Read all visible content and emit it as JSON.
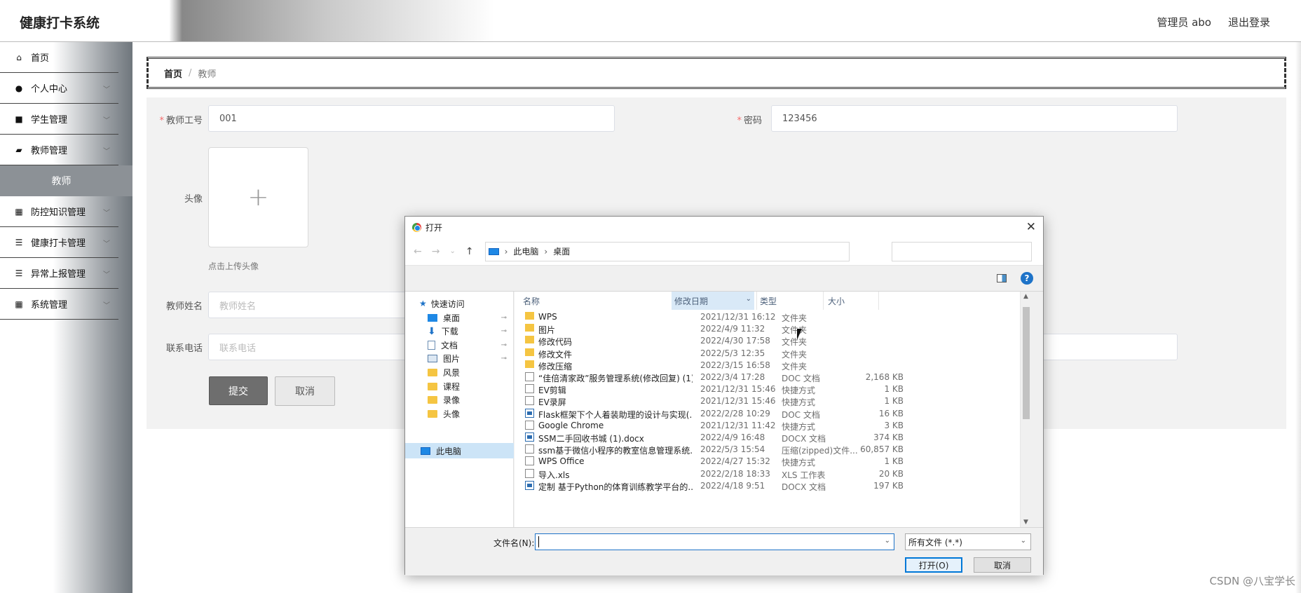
{
  "header": {
    "app_title": "健康打卡系统",
    "admin_label": "管理员 abo",
    "logout_label": "退出登录"
  },
  "sidebar": {
    "items": [
      {
        "label": "首页",
        "icon": "home-icon",
        "glyph": "⌂",
        "has_chevron": false
      },
      {
        "label": "个人中心",
        "icon": "user-icon",
        "glyph": "●",
        "has_chevron": true
      },
      {
        "label": "学生管理",
        "icon": "student-icon",
        "glyph": "■",
        "has_chevron": true
      },
      {
        "label": "教师管理",
        "icon": "teacher-icon",
        "glyph": "▰",
        "has_chevron": true
      }
    ],
    "active_sub": "教师",
    "items_after": [
      {
        "label": "防控知识管理",
        "icon": "grid-icon",
        "glyph": "▦",
        "has_chevron": true
      },
      {
        "label": "健康打卡管理",
        "icon": "list-icon",
        "glyph": "☰",
        "has_chevron": true
      },
      {
        "label": "异常上报管理",
        "icon": "list-icon",
        "glyph": "☰",
        "has_chevron": true
      },
      {
        "label": "系统管理",
        "icon": "grid-icon",
        "glyph": "▦",
        "has_chevron": true
      }
    ],
    "chevron": "﹀"
  },
  "breadcrumb": {
    "home": "首页",
    "separator": "/",
    "current": "教师"
  },
  "form": {
    "teacher_id_label": "教师工号",
    "teacher_id_value": "001",
    "password_label": "密码",
    "password_value": "123456",
    "avatar_label": "头像",
    "avatar_plus": "+",
    "upload_tip": "点击上传头像",
    "name_label": "教师姓名",
    "name_placeholder": "教师姓名",
    "phone_label": "联系电话",
    "phone_placeholder": "联系电话",
    "submit_label": "提交",
    "cancel_label": "取消",
    "required_mark": "*"
  },
  "dialog": {
    "title": "打开",
    "close_glyph": "✕",
    "back_glyph": "←",
    "forward_glyph": "→",
    "recent_glyph": "⌄",
    "up_glyph": "↑",
    "path": [
      "此电脑",
      "桌面"
    ],
    "path_sep": "›",
    "help_glyph": "?",
    "nav_pane": {
      "quick_access": "快速访问",
      "items": [
        {
          "label": "桌面",
          "icon": "desktop-icon",
          "pinned": true
        },
        {
          "label": "下载",
          "icon": "download-icon",
          "pinned": true
        },
        {
          "label": "文档",
          "icon": "document-icon",
          "pinned": true
        },
        {
          "label": "图片",
          "icon": "picture-icon",
          "pinned": true
        },
        {
          "label": "风景",
          "icon": "folder-icon",
          "pinned": false
        },
        {
          "label": "课程",
          "icon": "folder-icon",
          "pinned": false
        },
        {
          "label": "录像",
          "icon": "folder-icon",
          "pinned": false
        },
        {
          "label": "头像",
          "icon": "folder-icon",
          "pinned": false
        }
      ],
      "this_pc": "此电脑",
      "pin_glyph": "📌"
    },
    "columns": {
      "name": "名称",
      "date": "修改日期",
      "type": "类型",
      "size": "大小"
    },
    "files": [
      {
        "name": "WPS",
        "date": "2021/12/31 16:12",
        "type": "文件夹",
        "size": "",
        "icon": "folder"
      },
      {
        "name": "图片",
        "date": "2022/4/9 11:32",
        "type": "文件夹",
        "size": "",
        "icon": "folder"
      },
      {
        "name": "修改代码",
        "date": "2022/4/30 17:58",
        "type": "文件夹",
        "size": "",
        "icon": "folder"
      },
      {
        "name": "修改文件",
        "date": "2022/5/3 12:35",
        "type": "文件夹",
        "size": "",
        "icon": "folder"
      },
      {
        "name": "修改压缩",
        "date": "2022/3/15 16:58",
        "type": "文件夹",
        "size": "",
        "icon": "folder"
      },
      {
        "name": "“佳倍清家政”服务管理系统(修改回复) (1)...",
        "date": "2022/3/4 17:28",
        "type": "DOC 文档",
        "size": "2,168 KB",
        "icon": "doc"
      },
      {
        "name": "EV剪辑",
        "date": "2021/12/31 15:46",
        "type": "快捷方式",
        "size": "1 KB",
        "icon": "doc"
      },
      {
        "name": "EV录屏",
        "date": "2021/12/31 15:46",
        "type": "快捷方式",
        "size": "1 KB",
        "icon": "doc"
      },
      {
        "name": "Flask框架下个人着装助理的设计与实现(...",
        "date": "2022/2/28 10:29",
        "type": "DOC 文档",
        "size": "16 KB",
        "icon": "word"
      },
      {
        "name": "Google Chrome",
        "date": "2021/12/31 11:42",
        "type": "快捷方式",
        "size": "3 KB",
        "icon": "doc"
      },
      {
        "name": "SSM二手回收书城 (1).docx",
        "date": "2022/4/9 16:48",
        "type": "DOCX 文档",
        "size": "374 KB",
        "icon": "word"
      },
      {
        "name": "ssm基于微信小程序的教室信息管理系统...",
        "date": "2022/5/3 15:54",
        "type": "压缩(zipped)文件...",
        "size": "60,857 KB",
        "icon": "doc"
      },
      {
        "name": "WPS Office",
        "date": "2022/4/27 15:32",
        "type": "快捷方式",
        "size": "1 KB",
        "icon": "doc"
      },
      {
        "name": "导入.xls",
        "date": "2022/2/18 18:33",
        "type": "XLS 工作表",
        "size": "20 KB",
        "icon": "doc"
      },
      {
        "name": "定制 基于Python的体育训练教学平台的...",
        "date": "2022/4/18 9:51",
        "type": "DOCX 文档",
        "size": "197 KB",
        "icon": "word"
      }
    ],
    "filename_label": "文件名(N):",
    "filename_value": "",
    "filter_value": "所有文件 (*.*)",
    "open_label": "打开(O)",
    "cancel_label": "取消",
    "dropdown_glyph": "⌄",
    "scroll_up": "▲",
    "scroll_down": "▼"
  },
  "watermark": "CSDN @八宝学长"
}
